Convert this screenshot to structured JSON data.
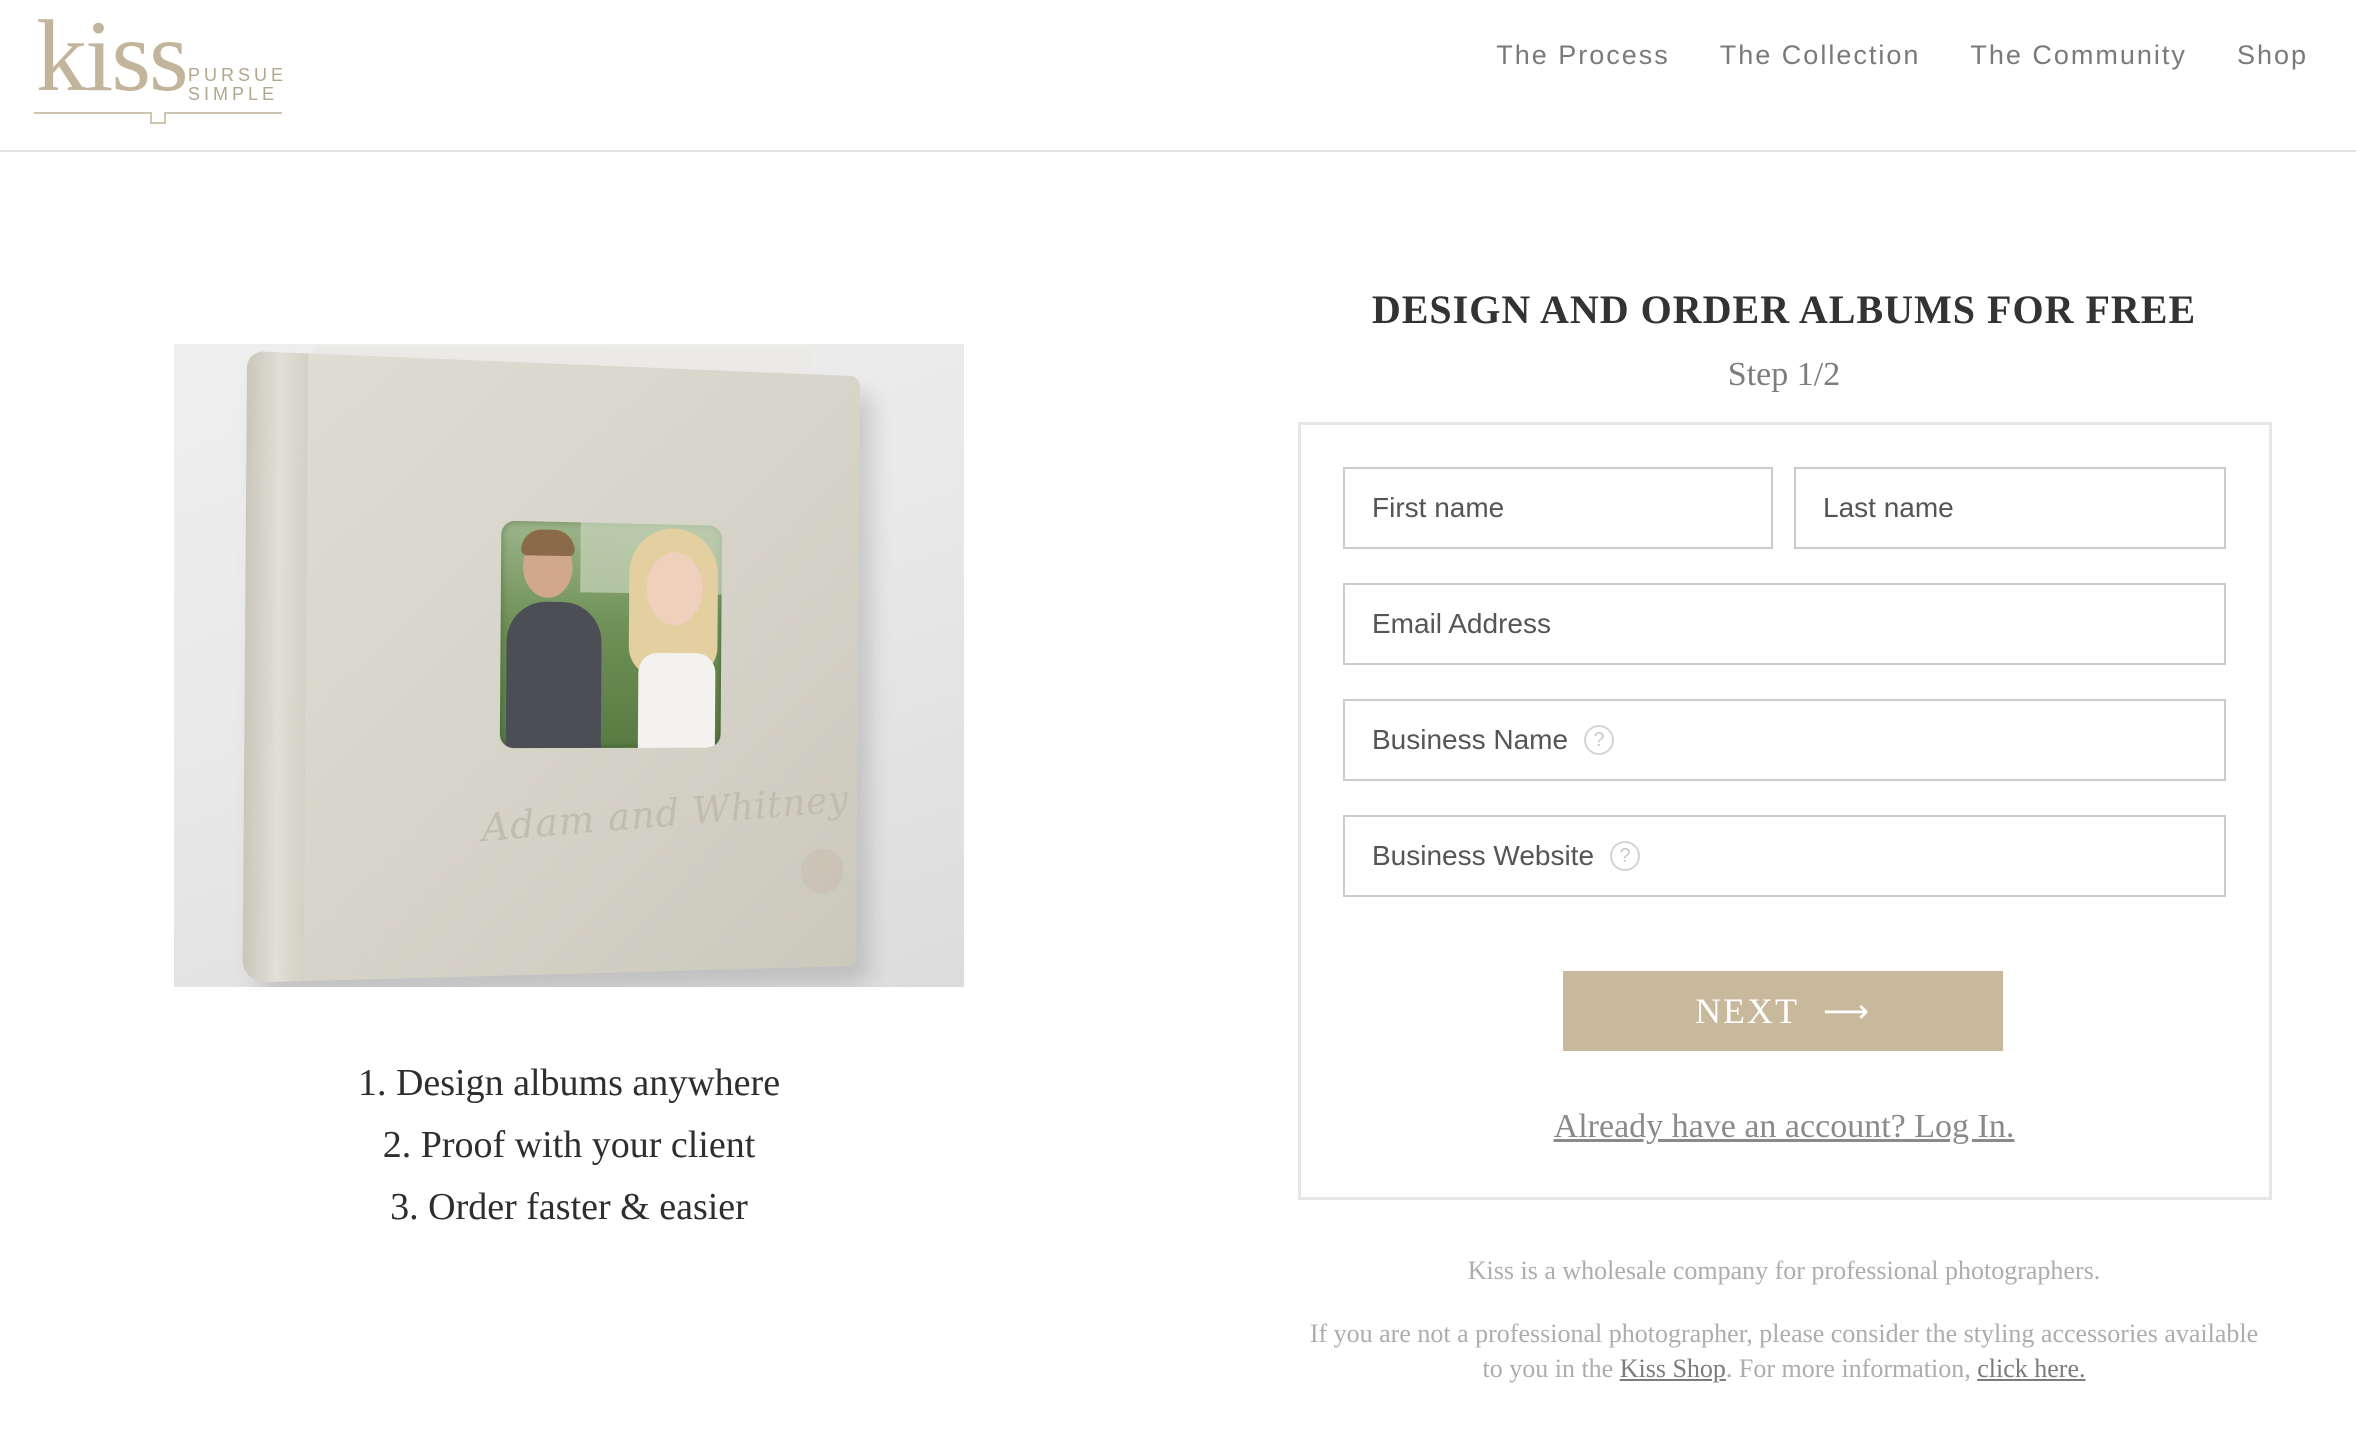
{
  "brand": {
    "logo_word": "kiss",
    "tagline_line1": "PURSUE",
    "tagline_line2": "SIMPLE",
    "accent_color": "#c8b99c"
  },
  "nav": {
    "items": [
      {
        "label": "The Process"
      },
      {
        "label": "The Collection"
      },
      {
        "label": "The Community"
      },
      {
        "label": "Shop"
      }
    ]
  },
  "hero": {
    "album_script_text": "Adam and Whitney",
    "features": [
      "1. Design albums anywhere",
      "2. Proof with your client",
      "3. Order faster & easier"
    ]
  },
  "form": {
    "title": "DESIGN AND ORDER ALBUMS FOR FREE",
    "step": "Step 1/2",
    "first_name_placeholder": "First name",
    "last_name_placeholder": "Last name",
    "email_placeholder": "Email Address",
    "business_name_placeholder": "Business Name",
    "business_website_placeholder": "Business Website",
    "help_icon": "question-circle-icon",
    "next_label": "NEXT",
    "next_icon": "arrow-right-icon",
    "login_link": "Already have an account? Log In."
  },
  "footer_notes": {
    "line1": "Kiss is a wholesale company for professional photographers.",
    "line2_part1": "If you are not a professional photographer, please consider the styling accessories available to you in the ",
    "shop_link": "Kiss Shop",
    "line2_part2": ". For more information, ",
    "info_link": "click here."
  }
}
